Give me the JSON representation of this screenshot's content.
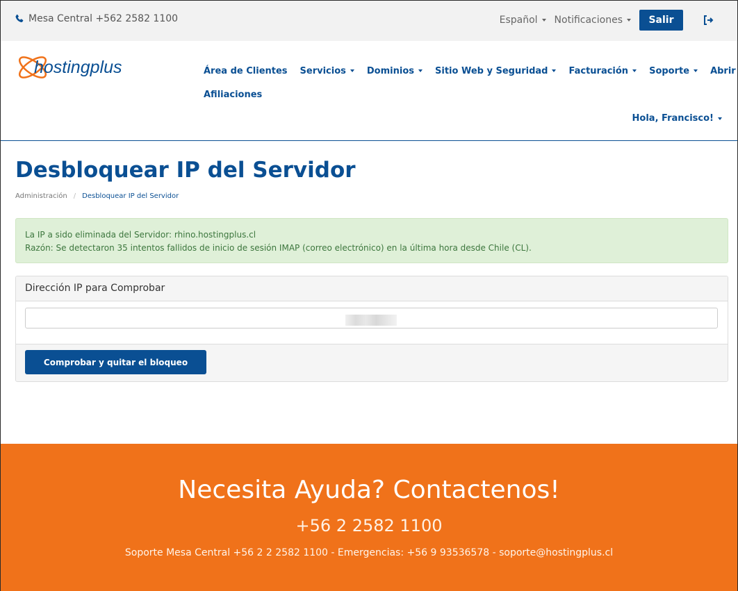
{
  "topbar": {
    "phone_label": "Mesa Central +562 2582 1100",
    "language": "Español",
    "notifications": "Notificaciones",
    "logout_label": "Salir"
  },
  "brand": {
    "logo_text": "hostingplus",
    "primary_color": "#0a4f93",
    "accent_color": "#f0721a"
  },
  "nav": {
    "row1": [
      {
        "label": "Área de Clientes",
        "dropdown": false
      },
      {
        "label": "Servicios",
        "dropdown": true
      },
      {
        "label": "Dominios",
        "dropdown": true
      },
      {
        "label": "Sitio Web y Seguridad",
        "dropdown": true
      },
      {
        "label": "Facturación",
        "dropdown": true
      },
      {
        "label": "Soporte",
        "dropdown": true
      },
      {
        "label": "Abrir Ticket",
        "dropdown": false
      }
    ],
    "row2": [
      {
        "label": "Afiliaciones",
        "dropdown": false
      }
    ],
    "user_greeting": "Hola, Francisco!"
  },
  "page": {
    "title": "Desbloquear IP del Servidor",
    "breadcrumb": [
      "Administración",
      "Desbloquear IP del Servidor"
    ]
  },
  "alert": {
    "line1": "La IP a sido eliminada del Servidor: rhino.hostingplus.cl",
    "line2": "Razón: Se detectaron 35 intentos fallidos de inicio de sesión IMAP (correo electrónico) en la última hora desde Chile (CL)."
  },
  "panel": {
    "title": "Dirección IP para Comprobar",
    "input_value": "",
    "button_label": "Comprobar y quitar el bloqueo"
  },
  "footer": {
    "heading": "Necesita Ayuda? Contactenos!",
    "phone": "+56 2 2582 1100",
    "contact": "Soporte Mesa Central +56 2 2 2582 1100 - Emergencias: +56 9 93536578 - soporte@hostingplus.cl"
  }
}
